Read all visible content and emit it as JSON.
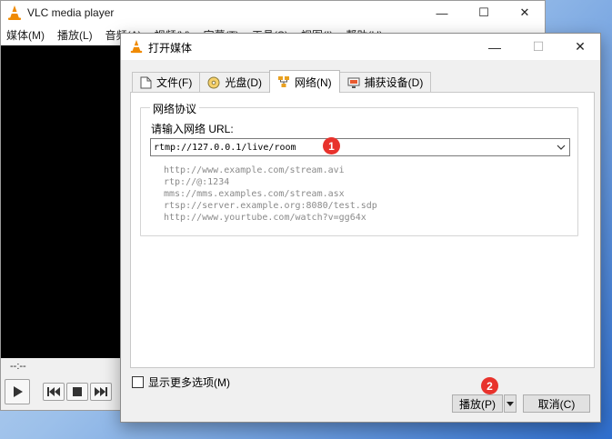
{
  "main_window": {
    "title": "VLC media player",
    "menu": [
      "媒体(M)",
      "播放(L)",
      "音频(A)",
      "视频(V)",
      "字幕(T)",
      "工具(S)",
      "视图(I)",
      "帮助(H)"
    ],
    "time_display": "--:--",
    "window_controls": {
      "minimize": "—",
      "maximize": "☐",
      "close": "✕"
    }
  },
  "dialog": {
    "title": "打开媒体",
    "window_controls": {
      "minimize": "—",
      "maximize": "☐",
      "close": "✕"
    },
    "tabs": [
      {
        "label": "文件(F)",
        "icon": "file-icon"
      },
      {
        "label": "光盘(D)",
        "icon": "disc-icon"
      },
      {
        "label": "网络(N)",
        "icon": "network-icon",
        "active": true
      },
      {
        "label": "捕获设备(D)",
        "icon": "capture-device-icon"
      }
    ],
    "network": {
      "group_title": "网络协议",
      "url_label": "请输入网络 URL:",
      "url_value": "rtmp://127.0.0.1/live/room",
      "examples": [
        "http://www.example.com/stream.avi",
        "rtp://@:1234",
        "mms://mms.examples.com/stream.asx",
        "rtsp://server.example.org:8080/test.sdp",
        "http://www.yourtube.com/watch?v=gg64x"
      ]
    },
    "more_options_label": "显示更多选项(M)",
    "play_label": "播放(P)",
    "cancel_label": "取消(C)"
  },
  "markers": [
    "1",
    "2"
  ],
  "colors": {
    "vlc_orange": "#f08a00",
    "marker_red": "#e8322c",
    "video_black": "#000000"
  }
}
